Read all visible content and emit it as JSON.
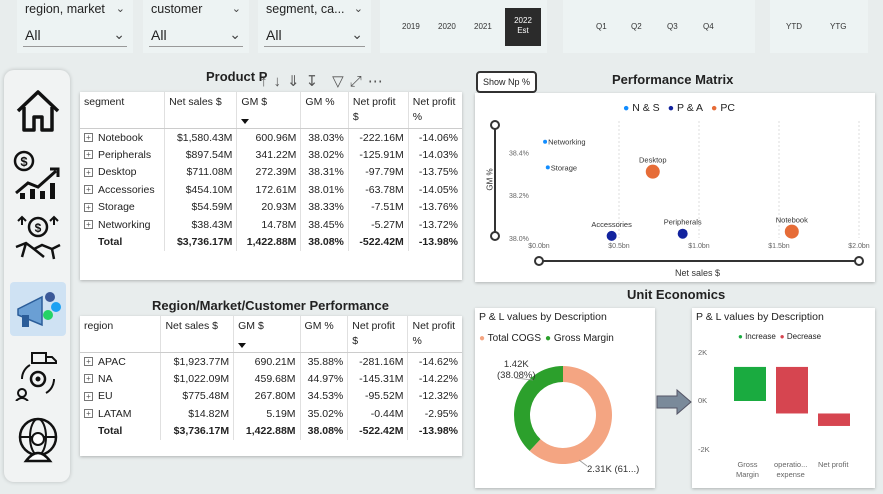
{
  "slicers": [
    {
      "label": "region, market",
      "value": "All"
    },
    {
      "label": "customer",
      "value": "All"
    },
    {
      "label": "segment, ca...",
      "value": "All"
    }
  ],
  "years": [
    "2019",
    "2020",
    "2021"
  ],
  "selected_year": {
    "year": "2022",
    "tag": "Est"
  },
  "quarters": [
    "Q1",
    "Q2",
    "Q3",
    "Q4"
  ],
  "ytd": [
    "YTD",
    "YTG"
  ],
  "product_title": "Product P",
  "product_table": {
    "headers": [
      "segment",
      "Net sales $",
      "GM $",
      "GM %",
      "Net profit $",
      "Net profit %"
    ],
    "rows": [
      [
        "Notebook",
        "$1,580.43M",
        "600.96M",
        "38.03%",
        "-222.16M",
        "-14.06%"
      ],
      [
        "Peripherals",
        "$897.54M",
        "341.22M",
        "38.02%",
        "-125.91M",
        "-14.03%"
      ],
      [
        "Desktop",
        "$711.08M",
        "272.39M",
        "38.31%",
        "-97.79M",
        "-13.75%"
      ],
      [
        "Accessories",
        "$454.10M",
        "172.61M",
        "38.01%",
        "-63.78M",
        "-14.05%"
      ],
      [
        "Storage",
        "$54.59M",
        "20.93M",
        "38.33%",
        "-7.51M",
        "-13.76%"
      ],
      [
        "Networking",
        "$38.43M",
        "14.78M",
        "38.45%",
        "-5.27M",
        "-13.72%"
      ]
    ],
    "total": [
      "Total",
      "$3,736.17M",
      "1,422.88M",
      "38.08%",
      "-522.42M",
      "-13.98%"
    ]
  },
  "show_np_button": "Show Np %",
  "performance_matrix": {
    "title": "Performance Matrix",
    "legend": [
      "N & S",
      "P & A",
      "PC"
    ],
    "legend_colors": [
      "#118dff",
      "#12239e",
      "#e66c37"
    ],
    "y_axis_label": "GM %",
    "x_axis_label": "Net sales $",
    "y_ticks": [
      "38.4%",
      "38.2%",
      "38.0%"
    ],
    "x_ticks": [
      "$0.0bn",
      "$0.5bn",
      "$1.0bn",
      "$1.5bn",
      "$2.0bn"
    ]
  },
  "chart_data": [
    {
      "type": "scatter",
      "title": "Performance Matrix",
      "xlabel": "Net sales $",
      "ylabel": "GM %",
      "xlim": [
        0,
        2.0
      ],
      "ylim": [
        38.0,
        38.5
      ],
      "series": [
        {
          "name": "N & S",
          "points": [
            {
              "label": "Networking",
              "x": 0.038,
              "y": 38.45
            },
            {
              "label": "Storage",
              "x": 0.055,
              "y": 38.33
            }
          ]
        },
        {
          "name": "P & A",
          "points": [
            {
              "label": "Accessories",
              "x": 0.454,
              "y": 38.01
            },
            {
              "label": "Peripherals",
              "x": 0.898,
              "y": 38.02
            }
          ]
        },
        {
          "name": "PC",
          "points": [
            {
              "label": "Desktop",
              "x": 0.711,
              "y": 38.31
            },
            {
              "label": "Notebook",
              "x": 1.58,
              "y": 38.03
            }
          ]
        }
      ]
    },
    {
      "type": "pie",
      "title": "P & L values by Description",
      "categories": [
        "Total COGS",
        "Gross Margin"
      ],
      "values": [
        2310,
        1420
      ],
      "labels": [
        "2.31K (61...)",
        "1.42K (38.08%)"
      ]
    },
    {
      "type": "bar",
      "title": "P & L values by Description",
      "categories": [
        "Gross Margin",
        "operational expense",
        "Net profit"
      ],
      "values": [
        1420,
        -1940,
        -520
      ],
      "legend": [
        "Increase",
        "Decrease"
      ],
      "yticks": [
        "2K",
        "0K",
        "-2K"
      ]
    }
  ],
  "region_title": "Region/Market/Customer Performance",
  "region_table": {
    "headers": [
      "region",
      "Net sales $",
      "GM $",
      "GM %",
      "Net profit $",
      "Net profit %"
    ],
    "rows": [
      [
        "APAC",
        "$1,923.77M",
        "690.21M",
        "35.88%",
        "-281.16M",
        "-14.62%"
      ],
      [
        "NA",
        "$1,022.09M",
        "459.68M",
        "44.97%",
        "-145.31M",
        "-14.22%"
      ],
      [
        "EU",
        "$775.48M",
        "267.80M",
        "34.53%",
        "-95.52M",
        "-12.32%"
      ],
      [
        "LATAM",
        "$14.82M",
        "5.19M",
        "35.02%",
        "-0.44M",
        "-2.95%"
      ]
    ],
    "total": [
      "Total",
      "$3,736.17M",
      "1,422.88M",
      "38.08%",
      "-522.42M",
      "-13.98%"
    ]
  },
  "unit_economics_title": "Unit Economics",
  "donut": {
    "title": "P & L values by Description",
    "legend": [
      "Total COGS",
      "Gross Margin"
    ],
    "colors": [
      "#f4a582",
      "#2ca02c"
    ],
    "label_gm": "1.42K",
    "label_gm_pct": "(38.08%)",
    "label_cogs": "2.31K (61...)"
  },
  "waterfall": {
    "title": "P & L values by Description",
    "legend": [
      "Increase",
      "Decrease"
    ],
    "colors": [
      "#1aab40",
      "#d64550"
    ],
    "yticks": [
      "2K",
      "0K",
      "-2K"
    ],
    "cats": [
      "Gross",
      "Margin",
      "operatio...",
      "expense",
      "Net profit"
    ]
  }
}
